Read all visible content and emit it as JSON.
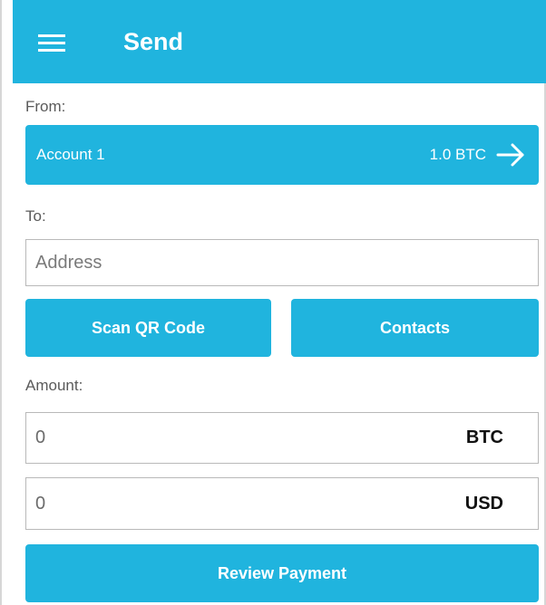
{
  "appbar": {
    "title": "Send",
    "menu_icon": "hamburger-menu-icon"
  },
  "from": {
    "label": "From:",
    "account_name": "Account 1",
    "balance": "1.0 BTC",
    "arrow_icon": "arrow-right-icon"
  },
  "to": {
    "label": "To:",
    "address_placeholder": "Address",
    "scan_button": "Scan QR Code",
    "contacts_button": "Contacts"
  },
  "amount": {
    "label": "Amount:",
    "btc_value": "0",
    "btc_unit": "BTC",
    "usd_value": "0",
    "usd_unit": "USD"
  },
  "review_button": "Review Payment",
  "colors": {
    "accent": "#20b4de",
    "text_muted": "#5a5a5a",
    "input_border": "#b9b9b9"
  }
}
